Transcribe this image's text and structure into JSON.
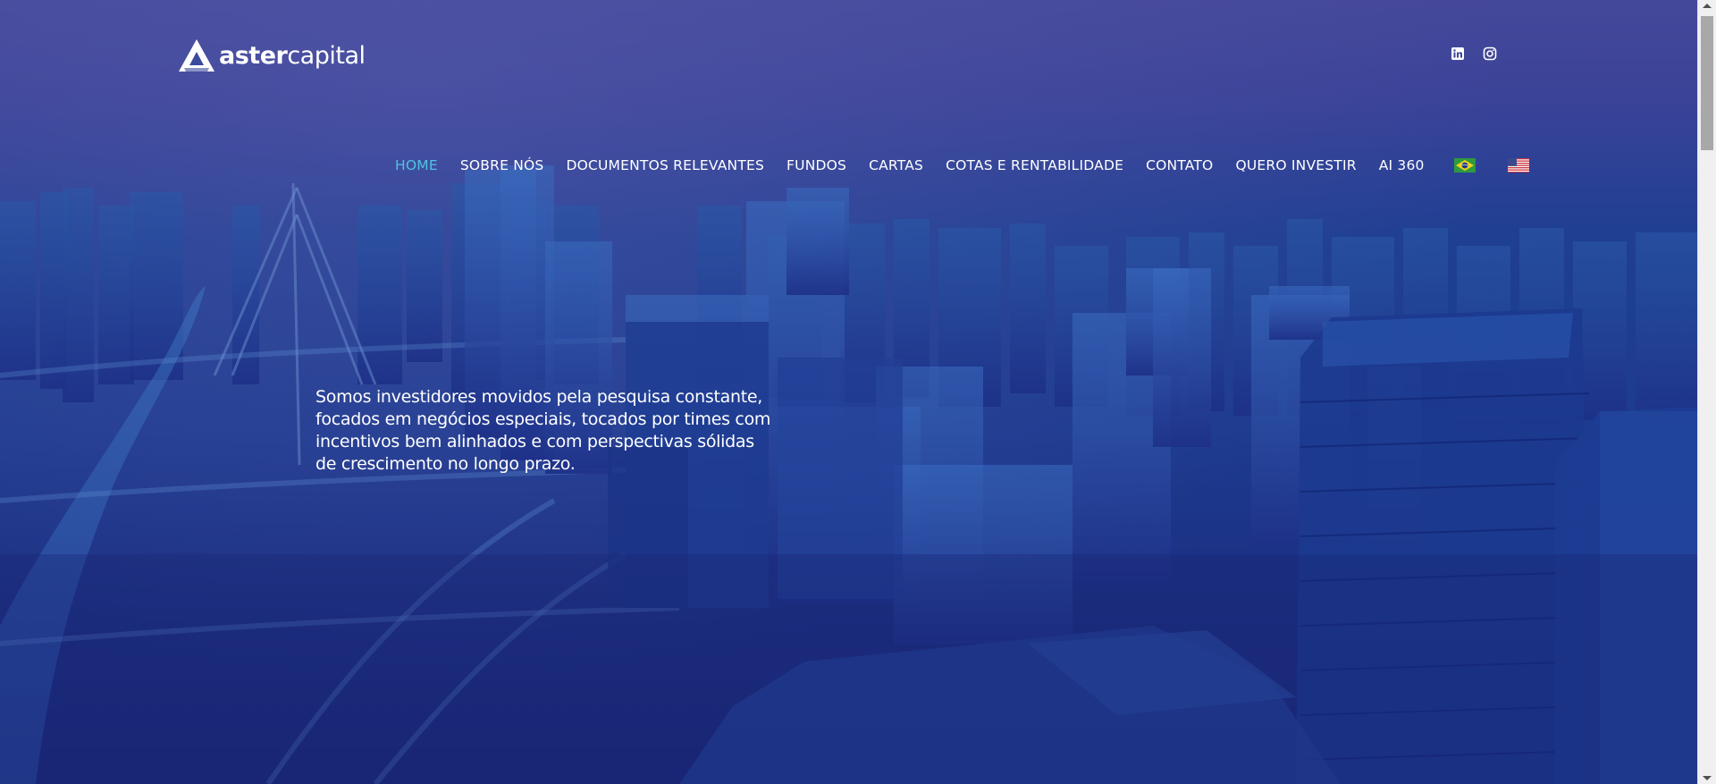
{
  "brand": {
    "name_bold": "aster",
    "name_light": "capital",
    "logo_icon": "aster-triangle-logo"
  },
  "social": {
    "items": [
      {
        "name": "linkedin",
        "icon": "linkedin-icon"
      },
      {
        "name": "instagram",
        "icon": "instagram-icon"
      }
    ]
  },
  "nav": {
    "items": [
      {
        "label": "HOME",
        "active": true
      },
      {
        "label": "SOBRE NÓS"
      },
      {
        "label": "DOCUMENTOS RELEVANTES"
      },
      {
        "label": "FUNDOS"
      },
      {
        "label": "CARTAS"
      },
      {
        "label": "COTAS E RENTABILIDADE"
      },
      {
        "label": "CONTATO"
      },
      {
        "label": "QUERO INVESTIR"
      },
      {
        "label": "AI 360"
      }
    ],
    "languages": [
      {
        "code": "pt-BR",
        "icon": "brazil-flag-icon"
      },
      {
        "code": "en-US",
        "icon": "usa-flag-icon"
      }
    ]
  },
  "hero": {
    "text": "Somos investidores movidos pela pesquisa constante, focados em negócios especiais, tocados por times com incentivos bem alinhados e com perspectivas sólidas de crescimento no longo prazo."
  },
  "colors": {
    "active_nav": "#4ec3e0",
    "overlay": "#1f3f92",
    "text": "#ffffff"
  }
}
